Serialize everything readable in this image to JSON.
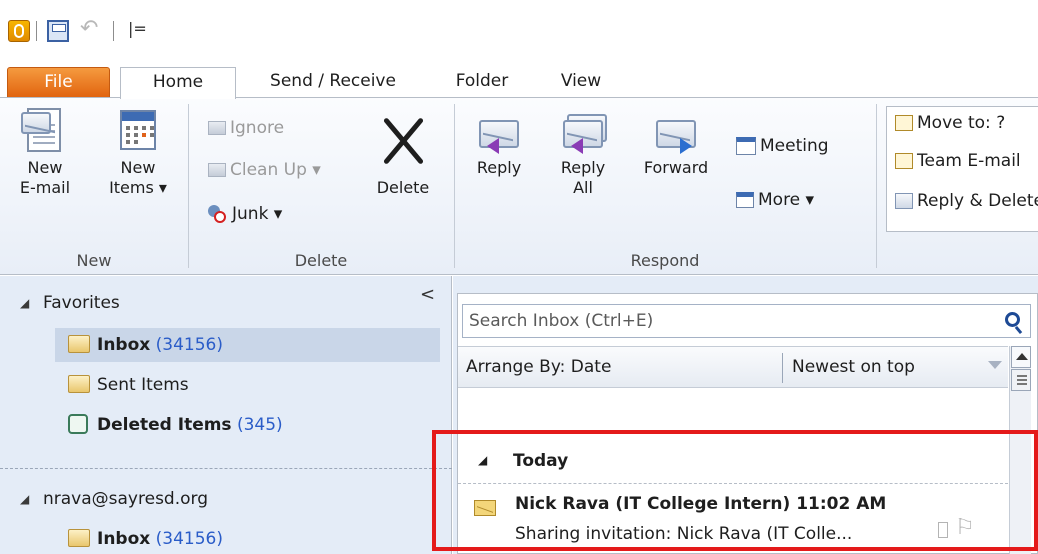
{
  "quick_access": {
    "undo_symbol": "↶",
    "more_symbol": "|="
  },
  "tabs": [
    "File",
    "Home",
    "Send / Receive",
    "Folder",
    "View"
  ],
  "ribbon": {
    "new_group": {
      "label": "New",
      "new_email": "New\nE-mail",
      "new_items": "New\nItems ▾"
    },
    "delete_group": {
      "label": "Delete",
      "ignore": "Ignore",
      "clean_up": "Clean Up ▾",
      "junk": "Junk ▾",
      "delete": "Delete"
    },
    "respond_group": {
      "label": "Respond",
      "reply": "Reply",
      "reply_all": "Reply\nAll",
      "forward": "Forward",
      "meeting": "Meeting",
      "more": "More ▾"
    },
    "quick_steps": {
      "move_to": "Move to: ?",
      "team_email": "Team E-mail",
      "reply_delete": "Reply & Delete"
    }
  },
  "nav": {
    "collapse_symbol": "<",
    "favorites_label": "Favorites",
    "favorites": [
      {
        "name": "Inbox",
        "count": "(34156)",
        "bold": true
      },
      {
        "name": "Sent Items",
        "count": "",
        "bold": false
      },
      {
        "name": "Deleted Items",
        "count": "(345)",
        "bold": true
      }
    ],
    "account_label": "nrava@sayresd.org",
    "account_folders": [
      {
        "name": "Inbox",
        "count": "(34156)",
        "bold": true
      }
    ]
  },
  "list": {
    "search_placeholder": "Search Inbox (Ctrl+E)",
    "arrange_by": "Arrange By: Date",
    "sort_order": "Newest on top",
    "group_label": "Today",
    "message": {
      "sender": "Nick Rava (IT College Intern)",
      "time": "11:02 AM",
      "subject": "Sharing invitation: Nick Rava (IT Colle..."
    }
  },
  "colors": {
    "file_tab": "#e1640f",
    "count_blue": "#2a5cc8",
    "highlight_red": "#e41a1a"
  }
}
